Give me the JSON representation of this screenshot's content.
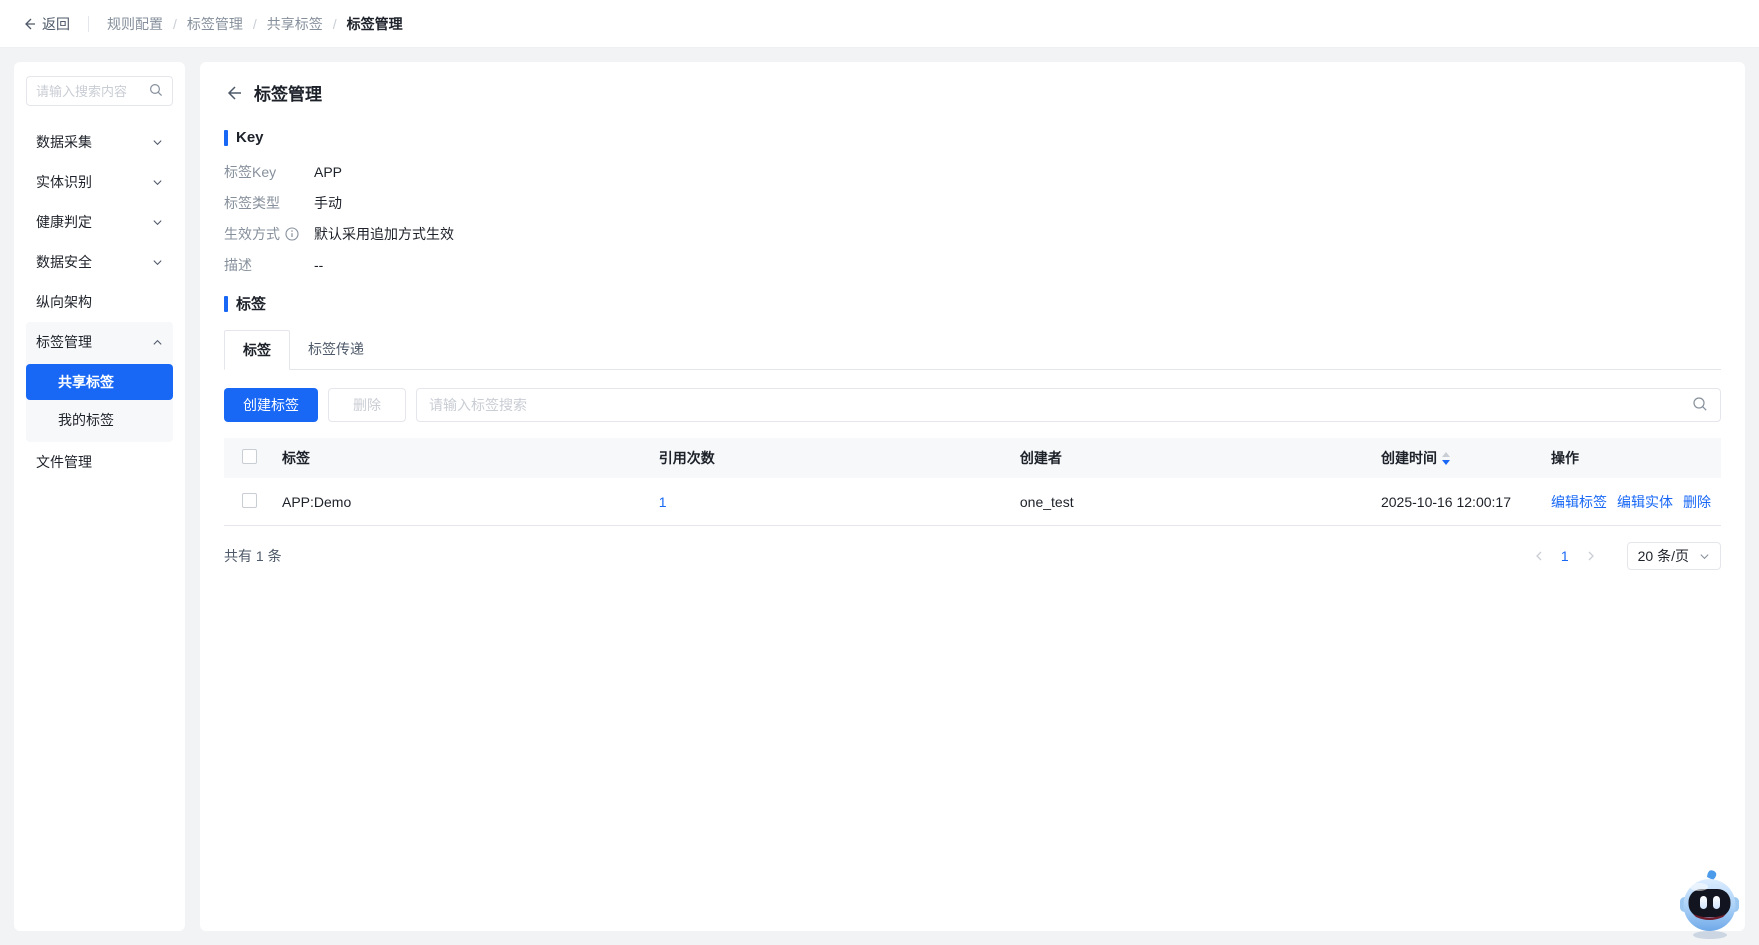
{
  "topbar": {
    "back_label": "返回",
    "separator": "/",
    "breadcrumb": [
      "规则配置",
      "标签管理",
      "共享标签",
      "标签管理"
    ]
  },
  "sidebar": {
    "search_placeholder": "请输入搜索内容",
    "items": [
      {
        "label": "数据采集"
      },
      {
        "label": "实体识别"
      },
      {
        "label": "健康判定"
      },
      {
        "label": "数据安全"
      },
      {
        "label": "纵向架构"
      },
      {
        "label": "标签管理",
        "expanded": true,
        "children": [
          {
            "label": "共享标签",
            "selected": true
          },
          {
            "label": "我的标签"
          }
        ]
      },
      {
        "label": "文件管理"
      }
    ]
  },
  "main": {
    "title": "标签管理",
    "key_section": {
      "heading": "Key",
      "fields": [
        {
          "label": "标签Key",
          "value": "APP"
        },
        {
          "label": "标签类型",
          "value": "手动"
        },
        {
          "label": "生效方式",
          "value": "默认采用追加方式生效",
          "info": true
        },
        {
          "label": "描述",
          "value": "--"
        }
      ]
    },
    "tag_section": {
      "heading": "标签",
      "tabs": [
        {
          "label": "标签",
          "active": true
        },
        {
          "label": "标签传递"
        }
      ],
      "toolbar": {
        "create_label": "创建标签",
        "delete_label": "删除",
        "search_placeholder": "请输入标签搜索"
      },
      "table": {
        "columns": [
          "标签",
          "引用次数",
          "创建者",
          "创建时间",
          "操作"
        ],
        "rows": [
          {
            "tag": "APP:Demo",
            "ref_count": "1",
            "creator": "one_test",
            "created_at": "2025-10-16 12:00:17",
            "actions": [
              "编辑标签",
              "编辑实体",
              "删除"
            ]
          }
        ]
      },
      "footer": {
        "total": "共有 1 条",
        "page": "1",
        "page_size": "20 条/页"
      }
    }
  },
  "colors": {
    "primary": "#1868f5",
    "text_secondary": "#86909c",
    "border": "#e5e6eb",
    "header_bg": "#f7f8fa"
  }
}
